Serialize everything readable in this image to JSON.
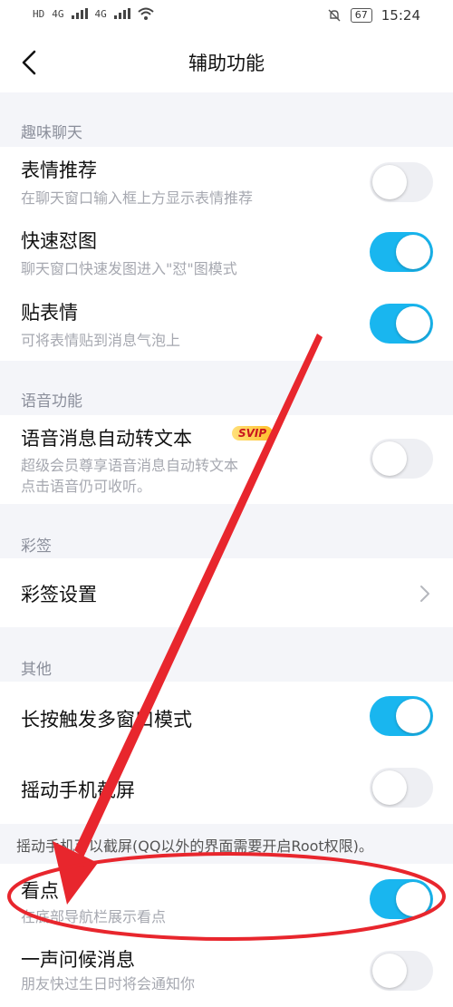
{
  "status_bar": {
    "left_indicators": [
      "HD",
      "4G",
      "4G"
    ],
    "battery": "67",
    "time": "15:24"
  },
  "header": {
    "title": "辅助功能"
  },
  "sections": [
    {
      "header": "趣味聊天",
      "items": [
        {
          "title": "表情推荐",
          "desc": "在聊天窗口输入框上方显示表情推荐",
          "toggle": "off"
        },
        {
          "title": "快速怼图",
          "desc": "聊天窗口快速发图进入\"怼\"图模式",
          "toggle": "on"
        },
        {
          "title": "贴表情",
          "desc": "可将表情贴到消息气泡上",
          "toggle": "on"
        }
      ]
    },
    {
      "header": "语音功能",
      "items": [
        {
          "title": "语音消息自动转文本",
          "badge": "SVIP",
          "desc_line1": "超级会员尊享语音消息自动转文本",
          "desc_line2": "点击语音仍可收听。",
          "toggle": "off"
        }
      ]
    },
    {
      "header": "彩签",
      "items": [
        {
          "title": "彩签设置"
        }
      ]
    },
    {
      "header": "其他",
      "items": [
        {
          "title": "长按触发多窗口模式",
          "toggle": "on"
        },
        {
          "title": "摇动手机截屏",
          "toggle": "off"
        }
      ],
      "note": "摇动手机可以截屏(QQ以外的界面需要开启Root权限)。"
    },
    {
      "items": [
        {
          "title": "看点",
          "desc": "在底部导航栏展示看点",
          "toggle": "on"
        },
        {
          "title": "一声问候消息",
          "desc": "朋友快过生日时将会通知你",
          "toggle": "off"
        }
      ]
    }
  ],
  "colors": {
    "accent": "#19b6ef",
    "annotation": "#e8262d",
    "badge_text": "#c9151e"
  }
}
